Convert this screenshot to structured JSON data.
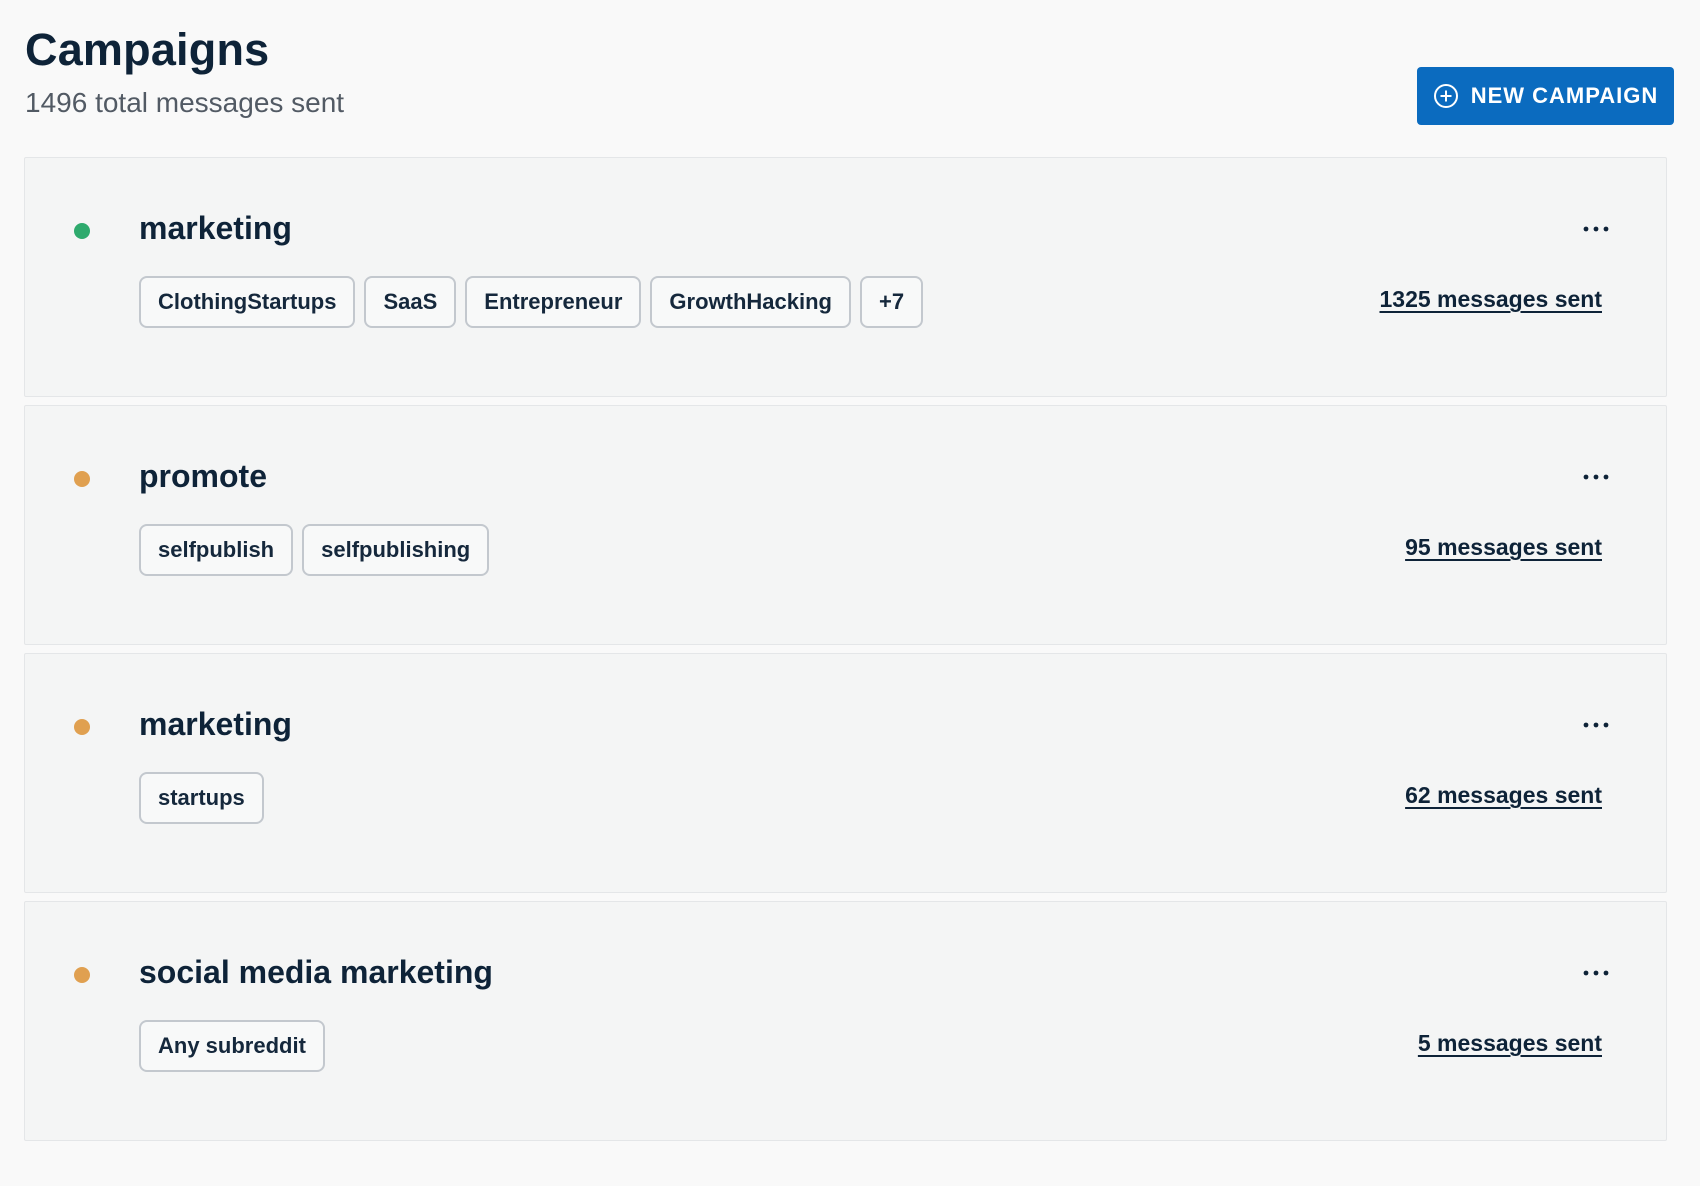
{
  "header": {
    "title": "Campaigns",
    "subtitle": "1496 total messages sent",
    "new_campaign_label": "NEW CAMPAIGN",
    "new_campaign_icon": "plus-circle-icon"
  },
  "colors": {
    "accent": "#0b6bbf",
    "status_active": "#2eaa6d",
    "status_paused": "#e0a050"
  },
  "campaigns": [
    {
      "name": "marketing",
      "status": "active",
      "status_color": "#2eaa6d",
      "tags": [
        "ClothingStartups",
        "SaaS",
        "Entrepreneur",
        "GrowthHacking",
        "+7"
      ],
      "messages_sent": "1325 messages sent",
      "menu_icon": "more-horizontal-icon"
    },
    {
      "name": "promote",
      "status": "paused",
      "status_color": "#e0a050",
      "tags": [
        "selfpublish",
        "selfpublishing"
      ],
      "messages_sent": "95 messages sent",
      "menu_icon": "more-horizontal-icon"
    },
    {
      "name": "marketing",
      "status": "paused",
      "status_color": "#e0a050",
      "tags": [
        "startups"
      ],
      "messages_sent": "62 messages sent",
      "menu_icon": "more-horizontal-icon"
    },
    {
      "name": "social media marketing",
      "status": "paused",
      "status_color": "#e0a050",
      "tags": [
        "Any subreddit"
      ],
      "messages_sent": "5 messages sent",
      "menu_icon": "more-horizontal-icon"
    }
  ]
}
